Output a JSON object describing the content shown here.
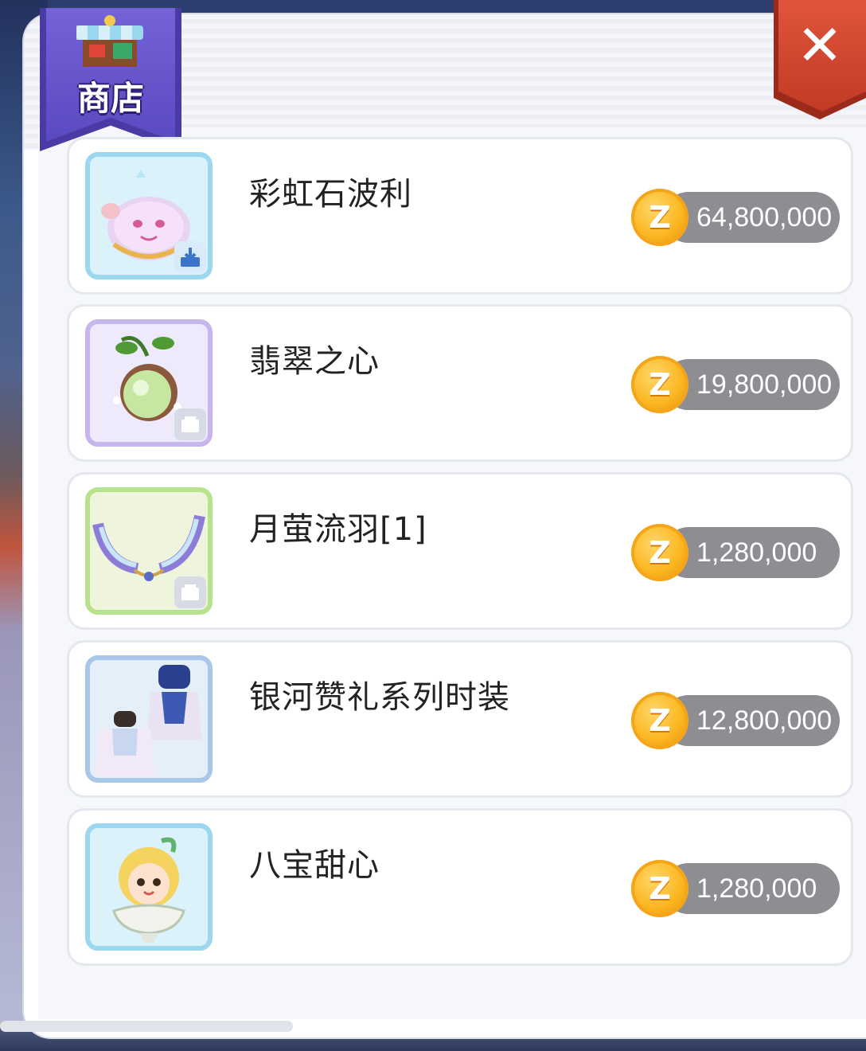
{
  "shop": {
    "title": "商店",
    "close_label": "✕"
  },
  "items": [
    {
      "name": "彩虹石波利",
      "price": "64,800,000",
      "currency": "Z",
      "frame": "cyan",
      "icon": "rainbow-poring-icon"
    },
    {
      "name": "翡翠之心",
      "price": "19,800,000",
      "currency": "Z",
      "frame": "purple",
      "icon": "emerald-heart-icon"
    },
    {
      "name": "月萤流羽[1]",
      "price": "1,280,000",
      "currency": "Z",
      "frame": "green",
      "icon": "moon-firefly-wings-icon"
    },
    {
      "name": "银河赞礼系列时装",
      "price": "12,800,000",
      "currency": "Z",
      "frame": "blue",
      "icon": "galaxy-costume-icon"
    },
    {
      "name": "八宝甜心",
      "price": "1,280,000",
      "currency": "Z",
      "frame": "cyan",
      "icon": "sweetheart-icon"
    }
  ],
  "colors": {
    "banner": "#5a49c0",
    "close": "#d4472f",
    "coin": "#fbb620",
    "price_pill": "#8d8d92"
  }
}
